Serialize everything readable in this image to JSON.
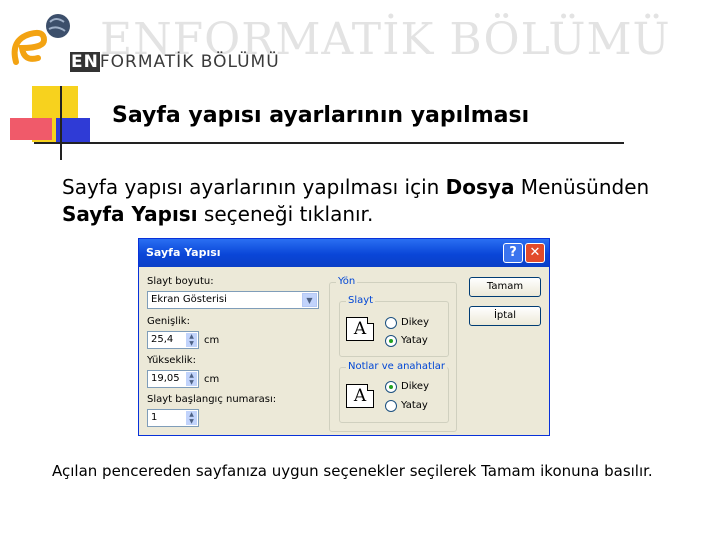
{
  "header": {
    "watermark": "ENFORMATİK BÖLÜMÜ",
    "logo_prefix": "EN",
    "logo_rest": "FORMATİK BÖLÜMÜ"
  },
  "slide": {
    "title": "Sayfa yapısı ayarlarının yapılması",
    "body_part1": "Sayfa yapısı ayarlarının yapılması için ",
    "body_bold1": "Dosya",
    "body_part2": " Menüsünden ",
    "body_bold2": "Sayfa Yapısı",
    "body_part3": " seçeneği tıklanır.",
    "caption": "Açılan pencereden sayfanıza uygun seçenekler seçilerek Tamam ikonuna basılır."
  },
  "dialog": {
    "title": "Sayfa Yapısı",
    "help_label": "?",
    "close_label": "✕",
    "slide_size_label": "Slayt boyutu:",
    "slide_size_value": "Ekran Gösterisi",
    "width_label": "Genişlik:",
    "width_value": "25,4",
    "height_label": "Yükseklik:",
    "height_value": "19,05",
    "unit": "cm",
    "start_number_label": "Slayt başlangıç numarası:",
    "start_number_value": "1",
    "orientation_group": "Yön",
    "slide_group": "Slayt",
    "notes_group": "Notlar ve anahatlar",
    "portrait_label": "Dikey",
    "landscape_label": "Yatay",
    "page_glyph": "A",
    "ok_label": "Tamam",
    "cancel_label": "İptal"
  }
}
